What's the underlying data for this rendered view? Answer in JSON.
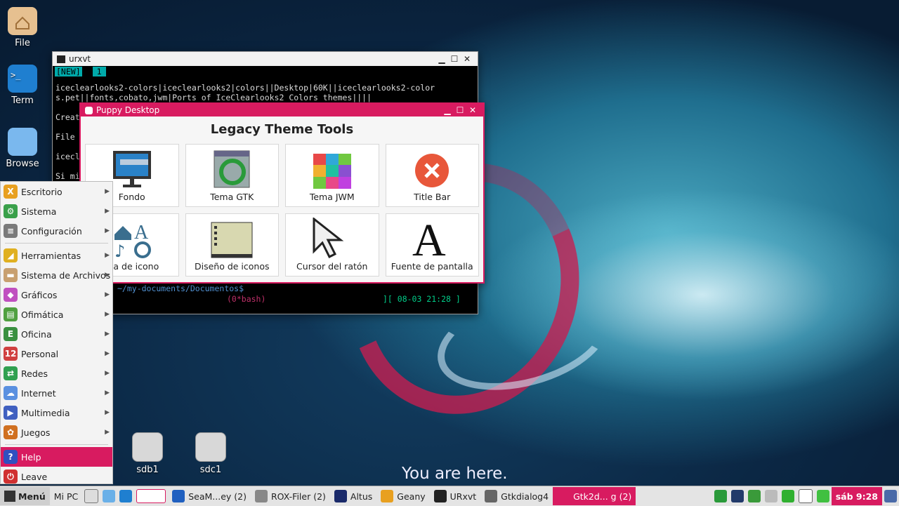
{
  "desktop": {
    "icons": [
      {
        "label": "File",
        "color": "#e6b98a"
      },
      {
        "label": "Term",
        "color": "#1f7fd0"
      },
      {
        "label": "Browse",
        "color": "#6ab0e8"
      }
    ],
    "drives": [
      {
        "label": "sdb1"
      },
      {
        "label": "sdc1"
      }
    ],
    "tagline": "You are here."
  },
  "urxvt": {
    "title": "urxvt",
    "tab_new": "[NEW]",
    "tab_num": "1",
    "lines": [
      "iceclearlooks2-colors|iceclearlooks2|colors||Desktop|60K||iceclearlooks2-color",
      "s.pet||fonts,cobato,jwm|Ports of IceClearlooks2 Colors themes||||",
      "",
      "Creat",
      "",
      "File",
      "",
      "icecl",
      "",
      "Si mi"
    ],
    "prompt": "~/my-documents/Documentos$",
    "status_left": "(0*bash)",
    "status_right": "][ 08-03 21:28 ]"
  },
  "puppy": {
    "title": "Puppy Desktop",
    "heading": "Legacy Theme Tools",
    "tools": [
      {
        "label": "Fondo",
        "icon": "monitor-paint-icon"
      },
      {
        "label": "Tema GTK",
        "icon": "gtk-refresh-icon"
      },
      {
        "label": "Tema JWM",
        "icon": "color-grid-icon"
      },
      {
        "label": "Title Bar",
        "icon": "close-circle-icon"
      },
      {
        "label": "ma de icono",
        "icon": "icon-theme-icon"
      },
      {
        "label": "Diseño de iconos",
        "icon": "icon-layout-icon"
      },
      {
        "label": "Cursor del ratón",
        "icon": "cursor-icon"
      },
      {
        "label": "Fuente de pantalla",
        "icon": "font-icon"
      }
    ]
  },
  "menu": {
    "items": [
      {
        "label": "Escritorio",
        "color": "#e8a020",
        "glyph": "X"
      },
      {
        "label": "Sistema",
        "color": "#3aa04a",
        "glyph": "⚙"
      },
      {
        "label": "Configuración",
        "color": "#7a7a7a",
        "glyph": "≡"
      },
      {
        "label": "Herramientas",
        "color": "#e0b020",
        "glyph": "◢"
      },
      {
        "label": "Sistema de Archivos",
        "color": "#c8a070",
        "glyph": "▬"
      },
      {
        "label": "Gráficos",
        "color": "#c050c0",
        "glyph": "◆"
      },
      {
        "label": "Ofimática",
        "color": "#50a040",
        "glyph": "▤"
      },
      {
        "label": "Oficina",
        "color": "#3a9040",
        "glyph": "E"
      },
      {
        "label": "Personal",
        "color": "#d04040",
        "glyph": "12"
      },
      {
        "label": "Redes",
        "color": "#30a050",
        "glyph": "⇄"
      },
      {
        "label": "Internet",
        "color": "#5a90e0",
        "glyph": "☁"
      },
      {
        "label": "Multimedia",
        "color": "#4060c0",
        "glyph": "▶"
      },
      {
        "label": "Juegos",
        "color": "#d07020",
        "glyph": "✿"
      }
    ],
    "help": "Help",
    "leave": "Leave"
  },
  "taskbar": {
    "menu_label": "Menú",
    "mipc": "Mi PC",
    "tasks": [
      {
        "label": "SeaM...ey (2)",
        "color": "#2060c0"
      },
      {
        "label": "ROX-Filer (2)",
        "color": "#888888"
      },
      {
        "label": "Altus",
        "color": "#1a2a6a"
      },
      {
        "label": "Geany",
        "color": "#e8a020"
      },
      {
        "label": "URxvt",
        "color": "#222222"
      },
      {
        "label": "Gtkdialog4",
        "color": "#666666"
      },
      {
        "label": "Gtk2d... g (2)",
        "color": "#d81b60"
      }
    ],
    "clock": "sáb 9:28",
    "accent": "#d81b60"
  }
}
